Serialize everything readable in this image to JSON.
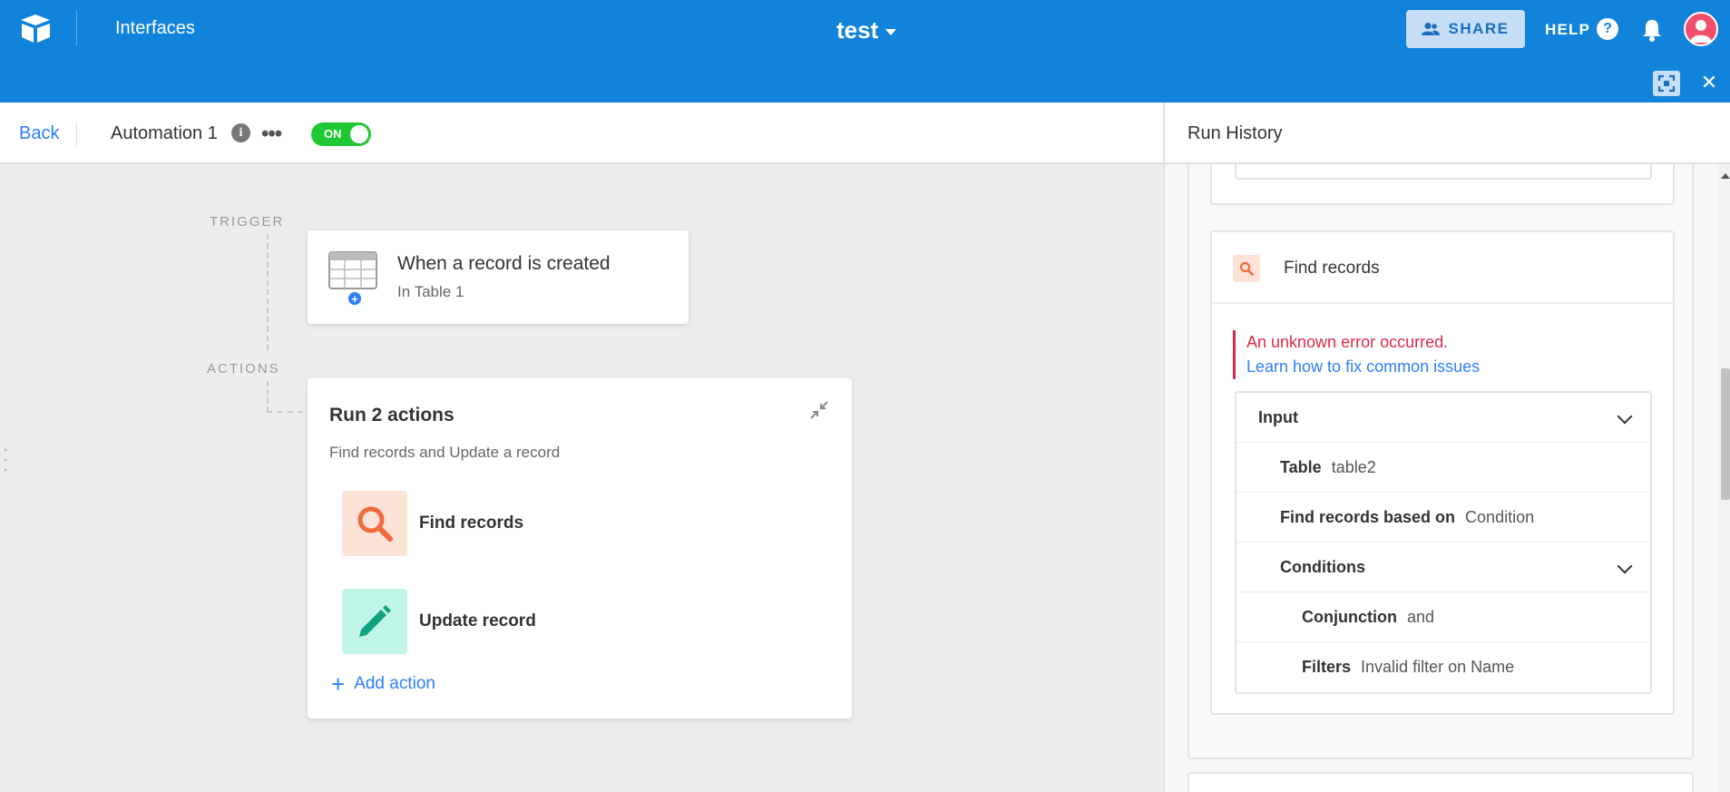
{
  "topbar": {
    "product_link": "Interfaces",
    "base_title": "test",
    "share_label": "SHARE",
    "help_label": "HELP",
    "help_glyph": "?",
    "close_glyph": "✕",
    "icons": [
      "airtable-logo-icon",
      "share-users-icon",
      "help-icon",
      "bell-icon",
      "avatar-icon",
      "expand-icon",
      "close-icon"
    ],
    "colors": {
      "bar": "#1283da",
      "share_bg": "#c6def6"
    }
  },
  "automation": {
    "back_label": "Back",
    "name": "Automation 1",
    "info_glyph": "i",
    "more_glyph": "•••",
    "toggle_label": "ON",
    "toggle_color": "#20c933"
  },
  "canvas": {
    "trigger_section": "TRIGGER",
    "actions_section": "ACTIONS",
    "trigger": {
      "title": "When a record is created",
      "subtitle": "In Table 1",
      "badge_glyph": "+"
    },
    "actions": {
      "title": "Run 2 actions",
      "subtitle": "Find records and Update a record",
      "items": [
        {
          "label": "Find records",
          "icon": "search-icon",
          "color": "#fde2d8"
        },
        {
          "label": "Update record",
          "icon": "pencil-icon",
          "color": "#c2f5e9"
        }
      ],
      "add_glyph": "+",
      "add_label": "Add action"
    }
  },
  "run_history": {
    "title": "Run History",
    "step": {
      "title": "Find records",
      "error": "An unknown error occurred.",
      "error_link": "Learn how to fix common issues",
      "rows": [
        {
          "key": "Input",
          "value": ""
        },
        {
          "key": "Table",
          "value": "table2"
        },
        {
          "key": "Find records based on",
          "value": "Condition"
        },
        {
          "key": "Conditions",
          "value": ""
        },
        {
          "key": "Conjunction",
          "value": "and"
        },
        {
          "key": "Filters",
          "value": "Invalid filter on Name"
        }
      ]
    },
    "error_color": "#e0294a",
    "link_color": "#2d7ff9"
  }
}
